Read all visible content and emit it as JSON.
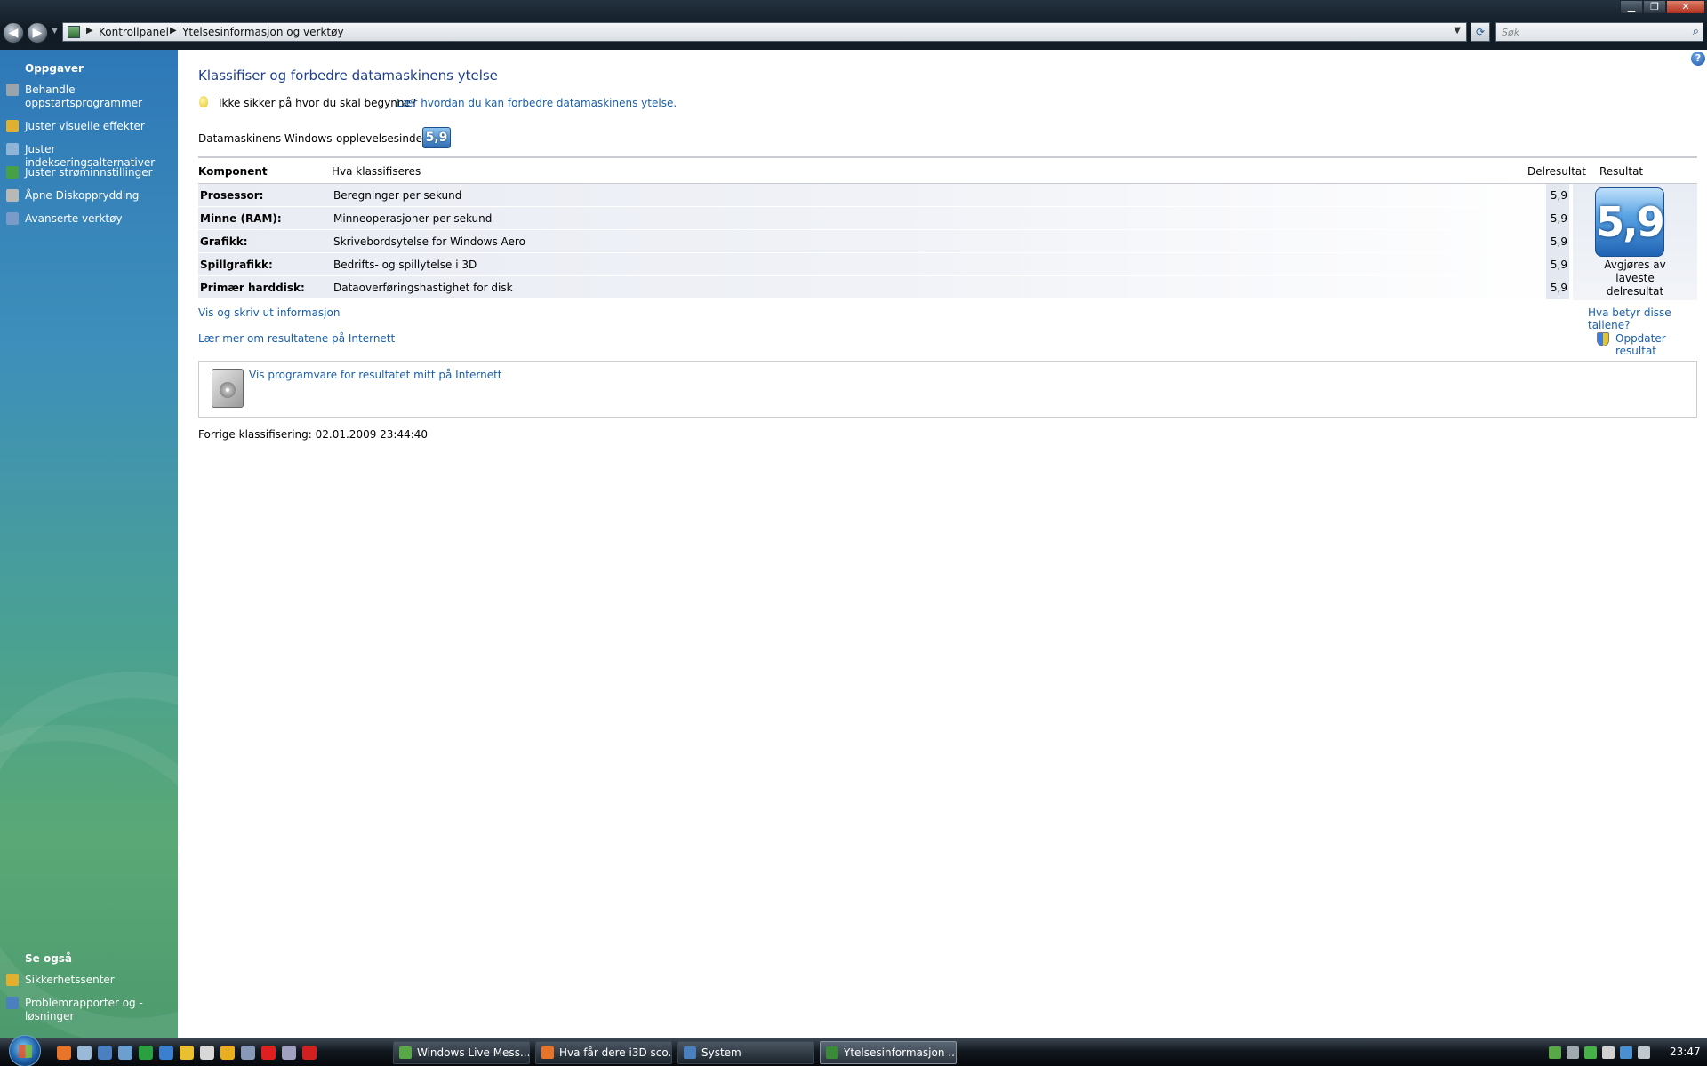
{
  "window": {
    "breadcrumb": [
      "Kontrollpanel",
      "Ytelsesinformasjon og verktøy"
    ],
    "search_placeholder": "Søk",
    "controls": {
      "minimize": "▁",
      "maximize": "❐",
      "close": "✕"
    }
  },
  "sidebar": {
    "tasks_heading": "Oppgaver",
    "tasks": [
      {
        "label": "Behandle oppstartsprogrammer",
        "icon": "startup-programs-icon",
        "color": "#9aa4ad"
      },
      {
        "label": "Juster visuelle effekter",
        "icon": "shield-icon",
        "color": "#e0b030"
      },
      {
        "label": "Juster indekseringsalternativer",
        "icon": "indexing-icon",
        "color": "#8fb4d8"
      },
      {
        "label": "Juster strøminnstillinger",
        "icon": "power-icon",
        "color": "#46a046"
      },
      {
        "label": "Åpne Diskopprydding",
        "icon": "disk-cleanup-icon",
        "color": "#b8b8b8"
      },
      {
        "label": "Avanserte verktøy",
        "icon": "advanced-tools-icon",
        "color": "#7a9ac8"
      }
    ],
    "see_also_heading": "Se også",
    "see_also": [
      {
        "label": "Sikkerhetssenter",
        "icon": "security-center-icon",
        "color": "#e0b030"
      },
      {
        "label": "Problemrapporter og -løsninger",
        "icon": "problem-reports-icon",
        "color": "#4a7fc0"
      }
    ]
  },
  "main": {
    "title": "Klassifiser og forbedre datamaskinens ytelse",
    "hint_question": "Ikke sikker på hvor du skal begynne?",
    "hint_link": "Lær hvordan du kan forbedre datamaskinens ytelse.",
    "index_label": "Datamaskinens Windows-opplevelsesindeks er",
    "index_value": "5,9",
    "table": {
      "headers": {
        "component": "Komponent",
        "what": "Hva klassifiseres",
        "subscore": "Delresultat",
        "result": "Resultat"
      },
      "rows": [
        {
          "component": "Prosessor:",
          "what": "Beregninger per sekund",
          "subscore": "5,9"
        },
        {
          "component": "Minne (RAM):",
          "what": "Minneoperasjoner per sekund",
          "subscore": "5,9"
        },
        {
          "component": "Grafikk:",
          "what": "Skrivebordsytelse for Windows Aero",
          "subscore": "5,9"
        },
        {
          "component": "Spillgrafikk:",
          "what": "Bedrifts- og spillytelse i 3D",
          "subscore": "5,9"
        },
        {
          "component": "Primær harddisk:",
          "what": "Dataoverføringshastighet for disk",
          "subscore": "5,9"
        }
      ],
      "result_value": "5,9",
      "result_caption": "Avgjøres av laveste delresultat"
    },
    "links": {
      "print_info": "Vis og skriv ut informasjon",
      "what_mean": "Hva betyr disse tallene?",
      "learn_more": "Lær mer om resultatene på Internett",
      "update": "Oppdater resultat"
    },
    "software_link": "Vis programvare for resultatet mitt på Internett",
    "previous_rating": "Forrige klassifisering: 02.01.2009 23:44:40"
  },
  "taskbar": {
    "quick_launch_colors": [
      "#e8742a",
      "#9ab8d8",
      "#4a7fc0",
      "#6a9fd0",
      "#2aa040",
      "#3a7fd0",
      "#e8c030",
      "#d8d8d8",
      "#e8b020",
      "#8898b8",
      "#e02020",
      "#a0a0c0",
      "#d02020"
    ],
    "tasks": [
      {
        "label": "Windows Live Mess...",
        "color": "#58a848"
      },
      {
        "label": "Hva får dere i3D sco...",
        "color": "#e8742a"
      },
      {
        "label": "System",
        "color": "#4a7fc0"
      },
      {
        "label": "Ytelsesinformasjon ...",
        "color": "#3a8a3a"
      }
    ],
    "tray_colors": [
      "#58a848",
      "#a0a8b0",
      "#48b048",
      "#d0d0d0",
      "#4a90d0",
      "#c0c8d0"
    ],
    "clock": "23:47"
  }
}
